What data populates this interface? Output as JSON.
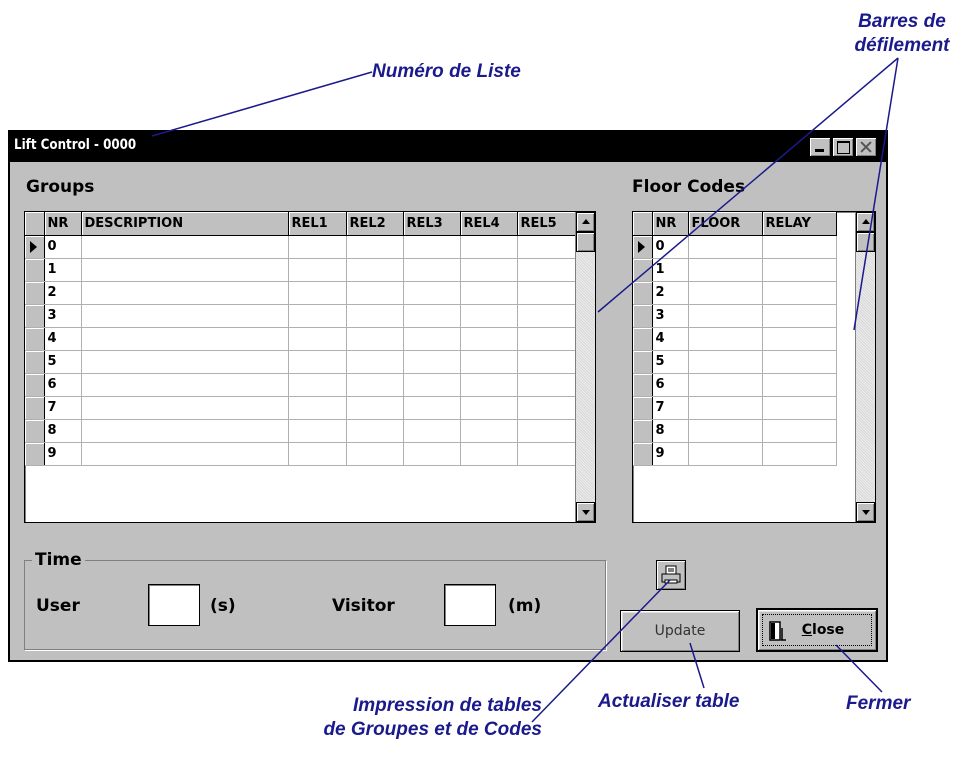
{
  "callouts": {
    "list_number": "Numéro de Liste",
    "scrollbars_line1": "Barres de",
    "scrollbars_line2": "défilement",
    "print_line1": "Impression de tables",
    "print_line2": "de Groupes et de Codes",
    "update_table": "Actualiser table",
    "close": "Fermer"
  },
  "window": {
    "title": "Lift Control - 0000"
  },
  "groups": {
    "label": "Groups",
    "columns": [
      "NR",
      "DESCRIPTION",
      "REL1",
      "REL2",
      "REL3",
      "REL4",
      "REL5"
    ],
    "rows": [
      "0",
      "1",
      "2",
      "3",
      "4",
      "5",
      "6",
      "7",
      "8",
      "9"
    ]
  },
  "floor_codes": {
    "label": "Floor Codes",
    "columns": [
      "NR",
      "FLOOR",
      "RELAY"
    ],
    "rows": [
      "0",
      "1",
      "2",
      "3",
      "4",
      "5",
      "6",
      "7",
      "8",
      "9"
    ]
  },
  "time": {
    "legend": "Time",
    "user_label": "User",
    "user_value": "",
    "user_unit": "(s)",
    "visitor_label": "Visitor",
    "visitor_value": "",
    "visitor_unit": "(m)"
  },
  "buttons": {
    "update": "Update",
    "close": "Close"
  },
  "icons": {
    "print": "printer-icon",
    "close": "door-icon",
    "minimize": "minimize-icon",
    "maximize": "maximize-icon",
    "close_window": "close-icon"
  },
  "colors": {
    "callout": "#1a1a8c",
    "titlebar": "#000000",
    "window": "#c0c0c0"
  }
}
